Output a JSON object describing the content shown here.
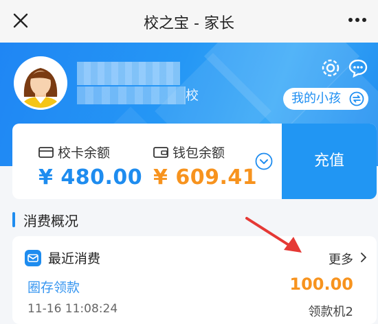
{
  "titlebar": {
    "title": "校之宝 - 家长"
  },
  "header": {
    "school_suffix": "校",
    "my_child_label": "我的小孩"
  },
  "balances": {
    "card_label": "校卡余额",
    "card_amount": "¥ 480.00",
    "wallet_label": "钱包余额",
    "wallet_amount": "¥ 609.41",
    "recharge_label": "充值"
  },
  "section": {
    "title": "消费概况"
  },
  "recent": {
    "title": "最近消费",
    "more_label": "更多",
    "item": {
      "title": "圈存领款",
      "amount": "100.00",
      "time": "11-16 11:08:24",
      "device": "领款机2"
    }
  },
  "colors": {
    "accent": "#1e8cef",
    "orange": "#f7931e",
    "annotation": "#e53935"
  }
}
